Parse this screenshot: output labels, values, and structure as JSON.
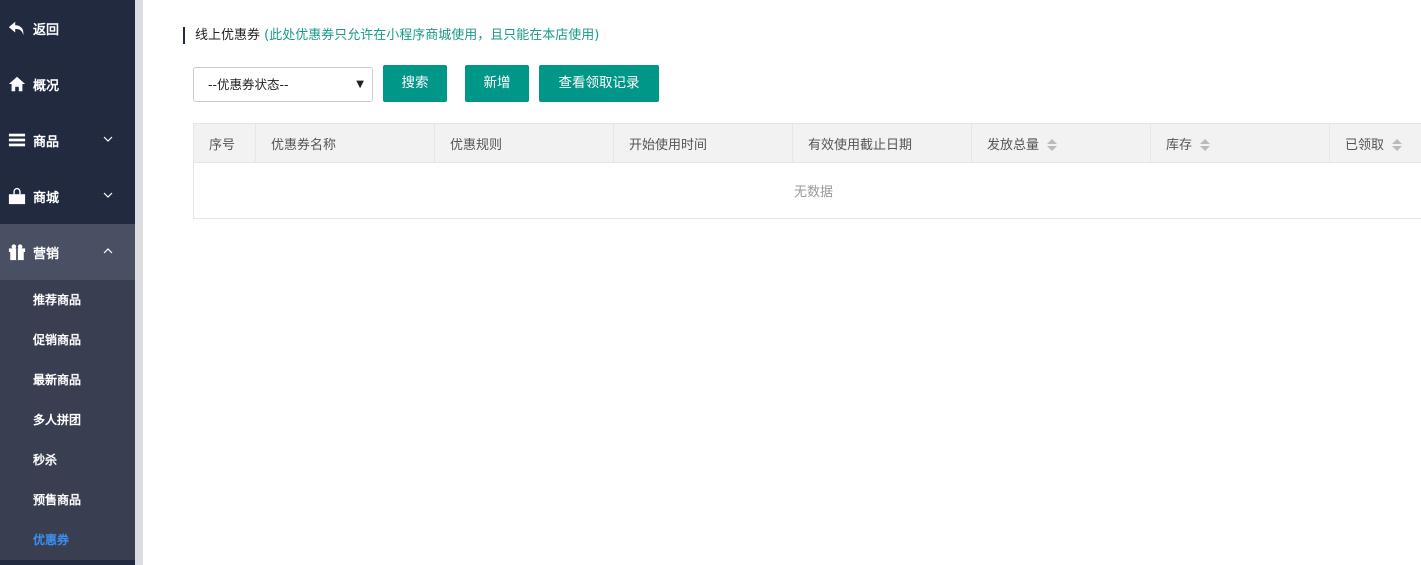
{
  "sidebar": {
    "back": "返回",
    "overview": "概况",
    "goods": "商品",
    "mall": "商城",
    "marketing": "营销",
    "marketing_items": [
      "推荐商品",
      "促销商品",
      "最新商品",
      "多人拼团",
      "秒杀",
      "预售商品",
      "优惠券"
    ],
    "active_item": "优惠券"
  },
  "header": {
    "title": "线上优惠券",
    "note": "(此处优惠券只允许在小程序商城使用，且只能在本店使用)"
  },
  "toolbar": {
    "status_select": "--优惠券状态--",
    "search": "搜索",
    "add": "新增",
    "records": "查看领取记录"
  },
  "table": {
    "columns": [
      "序号",
      "优惠券名称",
      "优惠规则",
      "开始使用时间",
      "有效使用截止日期",
      "发放总量",
      "库存",
      "已领取"
    ],
    "sortable": [
      "发放总量",
      "库存",
      "已领取"
    ],
    "empty": "无数据"
  },
  "colors": {
    "sidebar": "#222a40",
    "active_group": "#4a5064",
    "submenu": "#393f51",
    "accent": "#009688",
    "active_link": "#3b8ff0",
    "note": "#1a9a88"
  }
}
